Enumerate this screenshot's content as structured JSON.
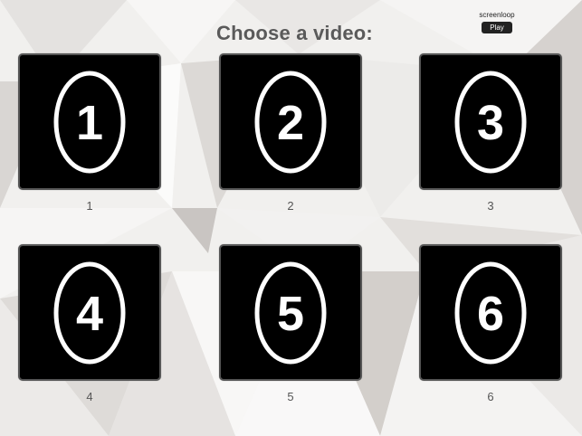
{
  "header": {
    "title": "Choose a video:",
    "brand": "screenloop",
    "play_label": "Play"
  },
  "videos": [
    {
      "number": "1",
      "caption": "1"
    },
    {
      "number": "2",
      "caption": "2"
    },
    {
      "number": "3",
      "caption": "3"
    },
    {
      "number": "4",
      "caption": "4"
    },
    {
      "number": "5",
      "caption": "5"
    },
    {
      "number": "6",
      "caption": "6"
    }
  ],
  "colors": {
    "tile_background": "#000000",
    "tile_border": "#555555",
    "ring": "#ffffff",
    "title": "#5a5a5a"
  }
}
